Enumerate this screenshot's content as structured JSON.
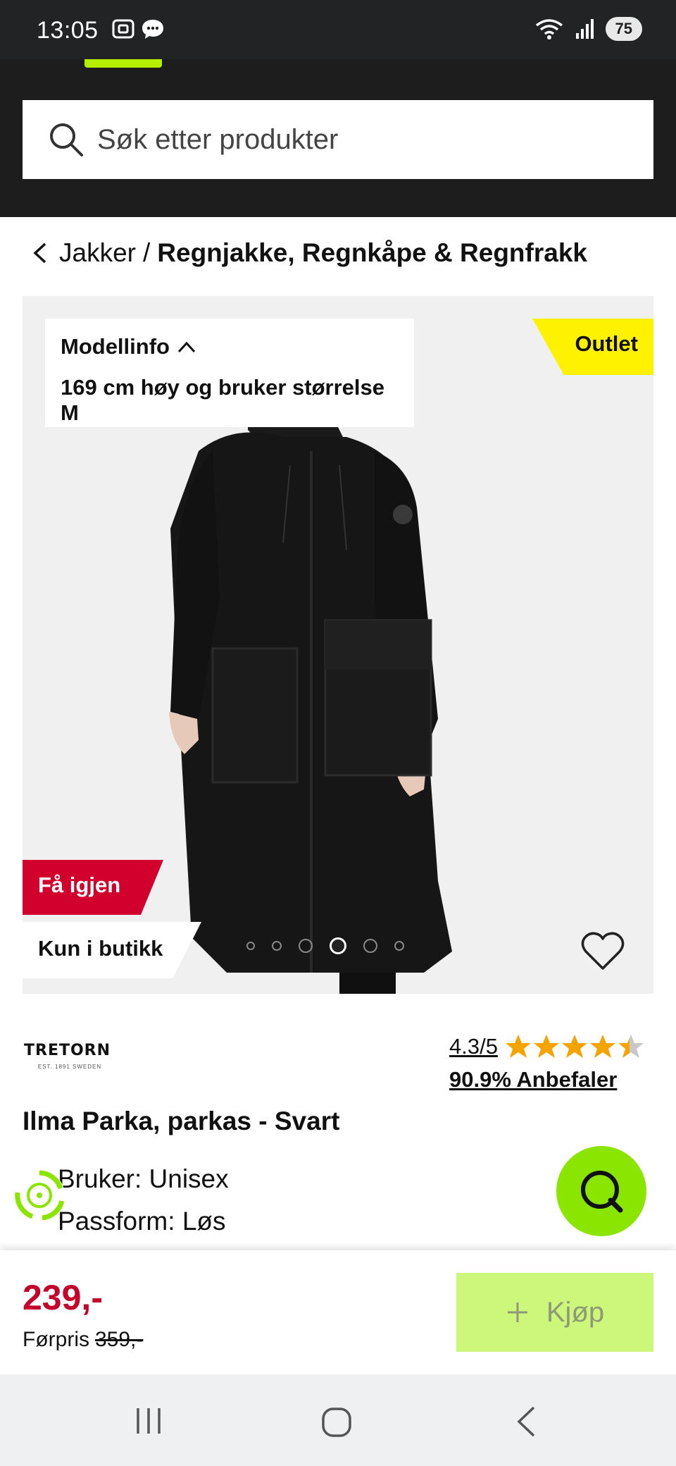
{
  "status_bar": {
    "time": "13:05",
    "battery": "75"
  },
  "search": {
    "placeholder": "Søk etter produkter"
  },
  "breadcrumb": {
    "parent": "Jakker",
    "separator": "/",
    "current": "Regnjakke, Regnkåpe & Regnfrakk"
  },
  "media": {
    "model_info_title": "Modellinfo",
    "model_info_text": "169 cm høy og bruker størrelse M",
    "outlet_badge": "Outlet",
    "fa_igjen_badge": "Få igjen",
    "kun_i_butikk_badge": "Kun i butikk",
    "image_count": 6,
    "active_image": 3
  },
  "product": {
    "brand": "TRETORN",
    "brand_tagline": "EST. 1891 SWEDEN",
    "rating": "4.3/5",
    "rating_value": 4.3,
    "rating_max": 5,
    "recommend": "90.9% Anbefaler",
    "title": "Ilma Parka, parkas - Svart",
    "spec_user": "Bruker: Unisex",
    "spec_fit": "Passform: Løs"
  },
  "buy_bar": {
    "price": "239,-",
    "before_label": "Førpris",
    "before_value": "359,-",
    "buy_label": "Kjøp"
  },
  "colors": {
    "accent_green": "#8ae600",
    "sale_red": "#c4002b",
    "outlet_yellow": "#fff200"
  },
  "icons": [
    "search-icon",
    "chevron-left-icon",
    "chevron-up-icon",
    "heart-icon",
    "star-icon",
    "recycle-icon",
    "chat-icon",
    "plus-icon"
  ]
}
